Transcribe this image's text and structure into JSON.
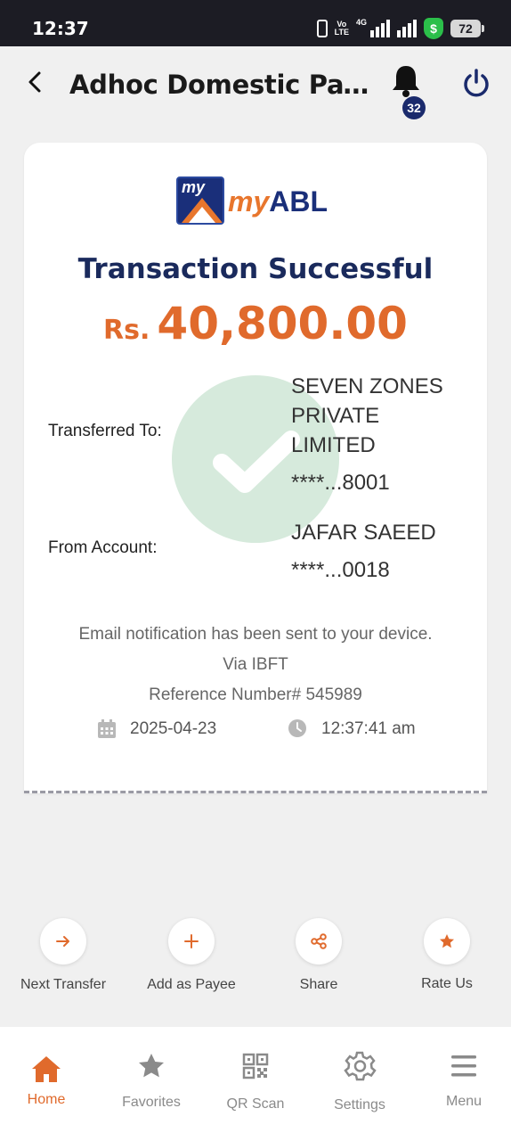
{
  "status_bar": {
    "time": "12:37",
    "volte_top": "Vo",
    "volte_bottom": "LTE",
    "network": "4G",
    "battery": "72"
  },
  "header": {
    "title": "Adhoc Domestic Paym...",
    "notification_count": "32"
  },
  "receipt": {
    "logo_text_my": "my",
    "logo_text_abl": "ABL",
    "logo_box_text": "my",
    "title": "Transaction Successful",
    "currency": "Rs.",
    "amount": "40,800.00",
    "transferred_to_label": "Transferred To:",
    "payee_name_lines": [
      "SEVEN ZONES",
      "PRIVATE",
      "LIMITED"
    ],
    "payee_account": "****...8001",
    "from_account_label": "From Account:",
    "sender_name": "JAFAR SAEED",
    "sender_account": "****...0018",
    "email_notice": "Email notification has been sent to your device.",
    "via": "Via IBFT",
    "reference": "Reference Number# 545989",
    "date": "2025-04-23",
    "time": "12:37:41 am"
  },
  "actions": [
    {
      "label": "Next Transfer",
      "icon": "arrow-right-icon"
    },
    {
      "label": "Add as Payee",
      "icon": "plus-icon"
    },
    {
      "label": "Share",
      "icon": "share-icon"
    },
    {
      "label": "Rate Us",
      "icon": "star-icon"
    }
  ],
  "bottom_nav": [
    {
      "label": "Home",
      "icon": "home-icon",
      "active": true
    },
    {
      "label": "Favorites",
      "icon": "star-icon",
      "active": false
    },
    {
      "label": "QR Scan",
      "icon": "qr-icon",
      "active": false
    },
    {
      "label": "Settings",
      "icon": "gear-icon",
      "active": false
    },
    {
      "label": "Menu",
      "icon": "menu-icon",
      "active": false
    }
  ],
  "colors": {
    "accent": "#e06a2c",
    "brand_navy": "#1a2a5c",
    "watermark_green": "#d6eadc"
  }
}
